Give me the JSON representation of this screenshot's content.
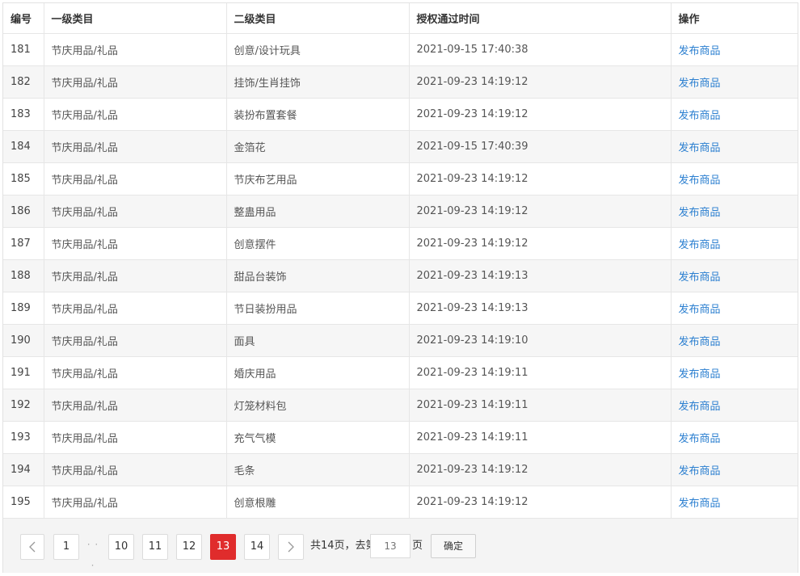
{
  "table": {
    "headers": [
      "编号",
      "一级类目",
      "二级类目",
      "授权通过时间",
      "操作"
    ],
    "rows": [
      {
        "id": "181",
        "cat1": "节庆用品/礼品",
        "cat2": "创意/设计玩具",
        "time": "2021-09-15 17:40:38",
        "action": "发布商品"
      },
      {
        "id": "182",
        "cat1": "节庆用品/礼品",
        "cat2": "挂饰/生肖挂饰",
        "time": "2021-09-23 14:19:12",
        "action": "发布商品"
      },
      {
        "id": "183",
        "cat1": "节庆用品/礼品",
        "cat2": "装扮布置套餐",
        "time": "2021-09-23 14:19:12",
        "action": "发布商品"
      },
      {
        "id": "184",
        "cat1": "节庆用品/礼品",
        "cat2": "金箔花",
        "time": "2021-09-15 17:40:39",
        "action": "发布商品"
      },
      {
        "id": "185",
        "cat1": "节庆用品/礼品",
        "cat2": "节庆布艺用品",
        "time": "2021-09-23 14:19:12",
        "action": "发布商品"
      },
      {
        "id": "186",
        "cat1": "节庆用品/礼品",
        "cat2": "整蛊用品",
        "time": "2021-09-23 14:19:12",
        "action": "发布商品"
      },
      {
        "id": "187",
        "cat1": "节庆用品/礼品",
        "cat2": "创意摆件",
        "time": "2021-09-23 14:19:12",
        "action": "发布商品"
      },
      {
        "id": "188",
        "cat1": "节庆用品/礼品",
        "cat2": "甜品台装饰",
        "time": "2021-09-23 14:19:13",
        "action": "发布商品"
      },
      {
        "id": "189",
        "cat1": "节庆用品/礼品",
        "cat2": "节日装扮用品",
        "time": "2021-09-23 14:19:13",
        "action": "发布商品"
      },
      {
        "id": "190",
        "cat1": "节庆用品/礼品",
        "cat2": "面具",
        "time": "2021-09-23 14:19:10",
        "action": "发布商品"
      },
      {
        "id": "191",
        "cat1": "节庆用品/礼品",
        "cat2": "婚庆用品",
        "time": "2021-09-23 14:19:11",
        "action": "发布商品"
      },
      {
        "id": "192",
        "cat1": "节庆用品/礼品",
        "cat2": "灯笼材料包",
        "time": "2021-09-23 14:19:11",
        "action": "发布商品"
      },
      {
        "id": "193",
        "cat1": "节庆用品/礼品",
        "cat2": "充气气模",
        "time": "2021-09-23 14:19:11",
        "action": "发布商品"
      },
      {
        "id": "194",
        "cat1": "节庆用品/礼品",
        "cat2": "毛条",
        "time": "2021-09-23 14:19:12",
        "action": "发布商品"
      },
      {
        "id": "195",
        "cat1": "节庆用品/礼品",
        "cat2": "创意根雕",
        "time": "2021-09-23 14:19:12",
        "action": "发布商品"
      }
    ]
  },
  "pagination": {
    "prev_icon": "chevron-left-icon",
    "next_icon": "chevron-right-icon",
    "first_page": "1",
    "ellipsis": "· · ·",
    "pages": [
      "10",
      "11",
      "12",
      "13",
      "14"
    ],
    "current_page": "13",
    "total_text": "共14页，去第",
    "goto_placeholder": "13",
    "page_suffix": "页",
    "confirm_label": "确定",
    "active_color": "#e02c2c"
  },
  "colors": {
    "link": "#2b7fd0",
    "row_alt": "#f6f6f6"
  }
}
